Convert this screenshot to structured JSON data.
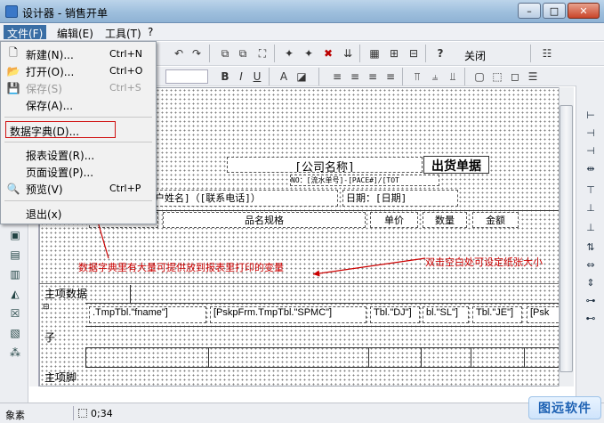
{
  "window": {
    "title": "设计器 - 销售开单",
    "minimize": "–",
    "maximize": "□",
    "close": "✕"
  },
  "menubar": {
    "file": "文件(F)",
    "edit": "编辑(E)",
    "tools": "工具(T)",
    "help": "?"
  },
  "toolbar": {
    "close_label": "关闭"
  },
  "file_menu": {
    "items": [
      {
        "label": "新建(N)...",
        "shortcut": "Ctrl+N",
        "icon": "new-file-icon"
      },
      {
        "label": "打开(O)...",
        "shortcut": "Ctrl+O",
        "icon": "open-folder-icon"
      },
      {
        "label": "保存(S)",
        "shortcut": "Ctrl+S",
        "icon": "save-icon",
        "disabled": true
      },
      {
        "label": "保存(A)...",
        "shortcut": "",
        "icon": ""
      },
      {
        "label": "数据字典(D)...",
        "shortcut": "",
        "icon": "",
        "highlighted": true
      },
      {
        "label": "报表设置(R)...",
        "shortcut": "",
        "icon": ""
      },
      {
        "label": "页面设置(P)...",
        "shortcut": "",
        "icon": ""
      },
      {
        "label": "预览(V)",
        "shortcut": "Ctrl+P",
        "icon": "preview-icon"
      },
      {
        "label": "退出(x)",
        "shortcut": "",
        "icon": ""
      }
    ]
  },
  "report": {
    "company_field": "[公司名称]",
    "doc_title": "出货单据",
    "serial_field": "NO：[流水单号]-[PACE#]/[TOT",
    "customer_fields": "户姓名]（[联系电话]）",
    "date_label": "日期：[日期]",
    "headers": [
      "",
      "品名规格",
      "单价",
      "数量",
      "金额"
    ],
    "band_main": "主项数据",
    "band_child": "子",
    "band_footer": "主项脚",
    "data_cells": [
      ".TmpTbl.\"fname\"]",
      "[PskpFrm.TmpTbl.\"SPMC\"]",
      "Tbl.\"DJ\"]",
      "bl.\"SL\"]",
      "Tbl.\"JE\"]",
      "[Psk"
    ]
  },
  "annotations": {
    "dictionary_note": "数据字典里有大量可提供放到报表里打印的变量",
    "blank_note": "双击空白处可设定纸张大小"
  },
  "statusbar": {
    "unit": "象素",
    "coords": "0;34"
  },
  "watermark": "图远软件",
  "colors": {
    "annotation": "#cc0000",
    "menu_highlight": "#3a6ea5"
  }
}
